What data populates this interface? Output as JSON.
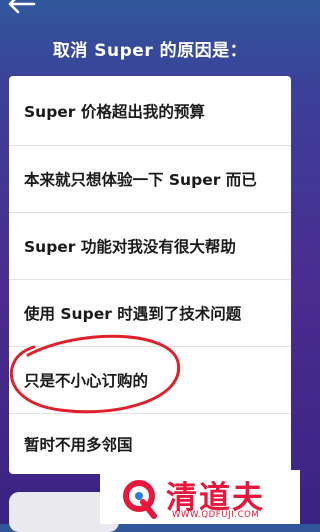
{
  "header": {
    "back_icon": "back-arrow-icon",
    "title": "取消 Super 的原因是："
  },
  "reasons": [
    {
      "label": "Super 价格超出我的预算"
    },
    {
      "label": "本来就只想体验一下 Super 而已"
    },
    {
      "label": "Super 功能对我没有很大帮助"
    },
    {
      "label": "使用 Super 时遇到了技术问题"
    },
    {
      "label": "只是不小心订购的"
    },
    {
      "label": "暂时不用多邻国"
    }
  ],
  "annotation": {
    "shape": "hand-drawn-circle",
    "color": "#e0202a"
  },
  "watermark": {
    "text": "清道夫",
    "url": "WWW.QDFUJI.COM",
    "color": "#e8173b"
  }
}
